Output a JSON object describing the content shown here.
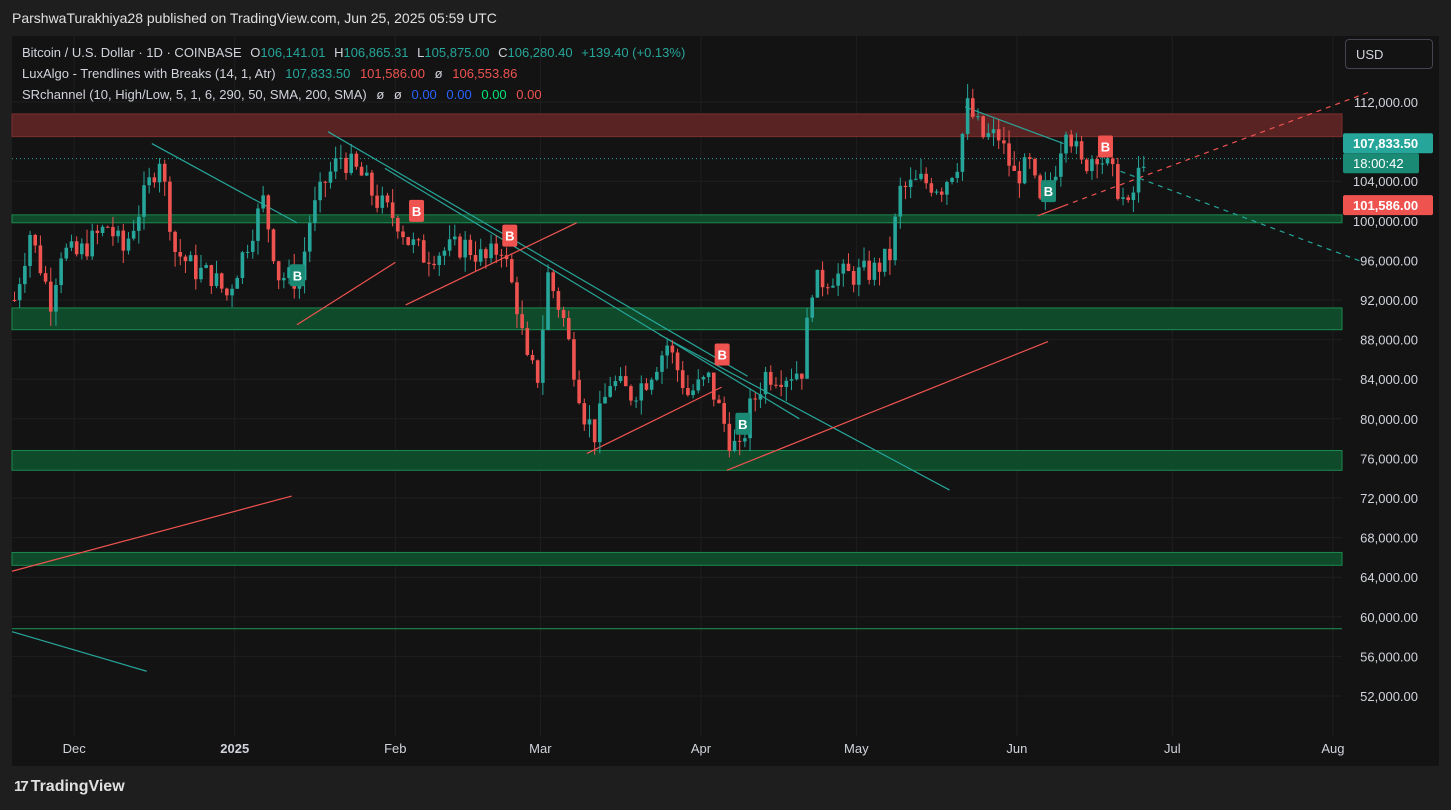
{
  "header": {
    "published": "ParshwaTurakhiya28 published on TradingView.com, Jun 25, 2025 05:59 UTC"
  },
  "legend": {
    "line1": {
      "symbol": "Bitcoin / U.S. Dollar · 1D · COINBASE",
      "o_label": "O",
      "o": "106,141.01",
      "h_label": "H",
      "h": "106,865.31",
      "l_label": "L",
      "l": "105,875.00",
      "c_label": "C",
      "c": "106,280.40",
      "change": "+139.40 (+0.13%)"
    },
    "line2": {
      "name": "LuxAlgo - Trendlines with Breaks (14, 1, Atr)",
      "v1": "107,833.50",
      "v2": "101,586.00",
      "v3": "ø",
      "v4": "106,553.86"
    },
    "line3": {
      "name": "SRchannel (10, High/Low, 5, 1, 6, 290, 50, SMA, 200, SMA)",
      "v1": "ø",
      "v2": "ø",
      "v3": "0.00",
      "v4": "0.00",
      "v5": "0.00",
      "v6": "0.00"
    }
  },
  "currency_button": "USD",
  "price_tags": {
    "upper": "107,833.50",
    "countdown": "18:00:42",
    "lower": "101,586.00"
  },
  "footer": {
    "logo_mark": "17",
    "logo_text": "TradingView"
  },
  "colors": {
    "up": "#26a69a",
    "down": "#ef5350",
    "zone": "#0f4a2b",
    "zone_border": "#1b8a4f",
    "resistance": "#5a2323",
    "background": "#131313"
  },
  "chart_data": {
    "type": "candlestick",
    "y_axis": {
      "range": [
        48000,
        114000
      ],
      "ticks": [
        112000,
        104000,
        100000,
        96000,
        92000,
        88000,
        84000,
        80000,
        76000,
        72000,
        68000,
        64000,
        60000,
        56000,
        52000
      ],
      "tick_labels": [
        "112,000.00",
        "104,000.00",
        "100,000.00",
        "96,000.00",
        "92,000.00",
        "88,000.00",
        "84,000.00",
        "80,000.00",
        "76,000.00",
        "72,000.00",
        "68,000.00",
        "64,000.00",
        "60,000.00",
        "56,000.00",
        "52,000.00"
      ]
    },
    "x_axis": {
      "range": [
        "2024-11-19",
        "2025-08-10"
      ],
      "ticks": [
        "2024-12-01",
        "2025-01-01",
        "2025-02-01",
        "2025-03-01",
        "2025-04-01",
        "2025-05-01",
        "2025-06-01",
        "2025-07-01",
        "2025-08-01"
      ],
      "tick_labels": [
        "Dec",
        "2025",
        "Feb",
        "Mar",
        "Apr",
        "May",
        "Jun",
        "Jul",
        "Aug"
      ]
    },
    "price_path": [
      [
        "2024-11-19",
        92000
      ],
      [
        "2024-11-22",
        98800
      ],
      [
        "2024-11-26",
        92000
      ],
      [
        "2024-11-28",
        97000
      ],
      [
        "2024-12-01",
        96500
      ],
      [
        "2024-12-04",
        98000
      ],
      [
        "2024-12-07",
        99500
      ],
      [
        "2024-12-10",
        97000
      ],
      [
        "2024-12-13",
        101000
      ],
      [
        "2024-12-17",
        106500
      ],
      [
        "2024-12-20",
        97000
      ],
      [
        "2024-12-24",
        95000
      ],
      [
        "2024-12-27",
        94500
      ],
      [
        "2024-12-30",
        92500
      ],
      [
        "2025-01-02",
        96500
      ],
      [
        "2025-01-06",
        102000
      ],
      [
        "2025-01-09",
        94500
      ],
      [
        "2025-01-13",
        94000
      ],
      [
        "2025-01-15",
        100000
      ],
      [
        "2025-01-18",
        104000
      ],
      [
        "2025-01-21",
        106500
      ],
      [
        "2025-01-25",
        104500
      ],
      [
        "2025-01-28",
        102000
      ],
      [
        "2025-02-01",
        100000
      ],
      [
        "2025-02-03",
        98000
      ],
      [
        "2025-02-06",
        96500
      ],
      [
        "2025-02-10",
        97000
      ],
      [
        "2025-02-14",
        97500
      ],
      [
        "2025-02-18",
        96000
      ],
      [
        "2025-02-21",
        97500
      ],
      [
        "2025-02-24",
        91500
      ],
      [
        "2025-02-26",
        85500
      ],
      [
        "2025-02-28",
        84300
      ],
      [
        "2025-03-02",
        94500
      ],
      [
        "2025-03-05",
        90000
      ],
      [
        "2025-03-09",
        80500
      ],
      [
        "2025-03-11",
        78500
      ],
      [
        "2025-03-14",
        83800
      ],
      [
        "2025-03-18",
        82500
      ],
      [
        "2025-03-21",
        84000
      ],
      [
        "2025-03-25",
        87500
      ],
      [
        "2025-03-29",
        82500
      ],
      [
        "2025-04-02",
        84000
      ],
      [
        "2025-04-06",
        78000
      ],
      [
        "2025-04-08",
        76500
      ],
      [
        "2025-04-10",
        81000
      ],
      [
        "2025-04-13",
        84500
      ],
      [
        "2025-04-17",
        84500
      ],
      [
        "2025-04-20",
        85000
      ],
      [
        "2025-04-22",
        93500
      ],
      [
        "2025-04-26",
        94500
      ],
      [
        "2025-04-30",
        94500
      ],
      [
        "2025-05-04",
        95000
      ],
      [
        "2025-05-07",
        96500
      ],
      [
        "2025-05-09",
        103000
      ],
      [
        "2025-05-13",
        104000
      ],
      [
        "2025-05-17",
        103500
      ],
      [
        "2025-05-20",
        106000
      ],
      [
        "2025-05-22",
        111500
      ],
      [
        "2025-05-25",
        108500
      ],
      [
        "2025-05-28",
        108500
      ],
      [
        "2025-05-31",
        104500
      ],
      [
        "2025-06-03",
        105500
      ],
      [
        "2025-06-05",
        101500
      ],
      [
        "2025-06-08",
        105500
      ],
      [
        "2025-06-10",
        110000
      ],
      [
        "2025-06-13",
        105500
      ],
      [
        "2025-06-16",
        107000
      ],
      [
        "2025-06-19",
        104500
      ],
      [
        "2025-06-22",
        101000
      ],
      [
        "2025-06-25",
        106500
      ]
    ],
    "support_zones": [
      [
        99800,
        100600
      ],
      [
        89000,
        91200
      ],
      [
        74800,
        76800
      ],
      [
        65200,
        66500
      ]
    ],
    "support_lines": [
      58800
    ],
    "resistance_zone": [
      108500,
      110800
    ],
    "current_price": 106280.4,
    "trendline_upper": 107833.5,
    "trendline_lower": 101586.0,
    "markers": [
      {
        "type": "B",
        "side": "bear",
        "date": "2025-02-05",
        "price": 101000
      },
      {
        "type": "B",
        "side": "bear",
        "date": "2025-02-23",
        "price": 98500
      },
      {
        "type": "B",
        "side": "bear",
        "date": "2025-04-05",
        "price": 86500
      },
      {
        "type": "B",
        "side": "bear",
        "date": "2025-06-18",
        "price": 107500
      },
      {
        "type": "B",
        "side": "bull",
        "date": "2025-01-13",
        "price": 94500
      },
      {
        "type": "B",
        "side": "bull",
        "date": "2025-04-09",
        "price": 79500
      },
      {
        "type": "B",
        "side": "bull",
        "date": "2025-06-07",
        "price": 103000
      }
    ],
    "trendlines_down": [
      [
        [
          "2024-12-16",
          107800
        ],
        [
          "2025-01-13",
          99800
        ]
      ],
      [
        [
          "2025-01-19",
          109000
        ],
        [
          "2025-04-10",
          84300
        ]
      ],
      [
        [
          "2025-01-30",
          105300
        ],
        [
          "2025-04-20",
          80000
        ]
      ],
      [
        [
          "2025-03-24",
          88500
        ],
        [
          "2025-05-19",
          72800
        ]
      ],
      [
        [
          "2025-05-22",
          111500
        ],
        [
          "2025-06-10",
          107800
        ]
      ],
      [
        [
          "2025-06-21",
          105000
        ],
        [
          "2025-08-07",
          95800
        ]
      ],
      [
        [
          "2024-11-19",
          58500
        ],
        [
          "2024-12-15",
          54500
        ]
      ]
    ],
    "trendlines_up": [
      [
        [
          "2025-01-13",
          89500
        ],
        [
          "2025-02-01",
          95800
        ]
      ],
      [
        [
          "2025-02-03",
          91500
        ],
        [
          "2025-03-08",
          99800
        ]
      ],
      [
        [
          "2025-03-10",
          76500
        ],
        [
          "2025-04-05",
          83200
        ]
      ],
      [
        [
          "2025-04-06",
          74800
        ],
        [
          "2025-06-07",
          87800
        ]
      ],
      [
        [
          "2024-11-19",
          64600
        ],
        [
          "2025-01-12",
          72200
        ]
      ],
      [
        [
          "2025-06-05",
          100500
        ],
        [
          "2025-06-10",
          101500
        ]
      ],
      [
        [
          "2025-06-10",
          101500
        ],
        [
          "2025-08-08",
          113000
        ]
      ]
    ]
  }
}
